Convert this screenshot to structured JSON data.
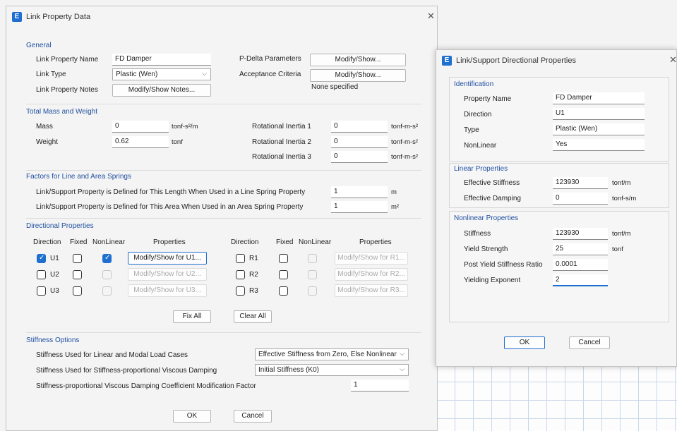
{
  "main": {
    "title": "Link Property Data",
    "general": {
      "header": "General",
      "name_label": "Link Property Name",
      "name_value": "FD Damper",
      "type_label": "Link Type",
      "type_value": "Plastic (Wen)",
      "notes_label": "Link Property Notes",
      "notes_button": "Modify/Show Notes...",
      "pdelta_label": "P-Delta Parameters",
      "pdelta_button": "Modify/Show...",
      "accept_label": "Acceptance Criteria",
      "accept_button": "Modify/Show...",
      "none_specified": "None specified"
    },
    "mass": {
      "header": "Total Mass and Weight",
      "mass_label": "Mass",
      "mass_value": "0",
      "mass_unit": "tonf-s²/m",
      "weight_label": "Weight",
      "weight_value": "0.62",
      "weight_unit": "tonf",
      "ri1_label": "Rotational Inertia 1",
      "ri1_value": "0",
      "ri2_label": "Rotational Inertia 2",
      "ri2_value": "0",
      "ri3_label": "Rotational Inertia 3",
      "ri3_value": "0",
      "ri_unit": "tonf-m-s²"
    },
    "factors": {
      "header": "Factors for Line and Area Springs",
      "line_text": "Link/Support Property is Defined for This Length When Used in a Line Spring Property",
      "line_value": "1",
      "line_unit": "m",
      "area_text": "Link/Support Property is Defined for This Area When Used in an Area Spring Property",
      "area_value": "1",
      "area_unit": "m²"
    },
    "directional": {
      "header": "Directional Properties",
      "col_direction": "Direction",
      "col_fixed": "Fixed",
      "col_nonlinear": "NonLinear",
      "col_properties": "Properties",
      "rows_left": [
        {
          "dir": "U1",
          "button": "Modify/Show for U1..."
        },
        {
          "dir": "U2",
          "button": "Modify/Show for U2..."
        },
        {
          "dir": "U3",
          "button": "Modify/Show for U3..."
        }
      ],
      "rows_right": [
        {
          "dir": "R1",
          "button": "Modify/Show for R1..."
        },
        {
          "dir": "R2",
          "button": "Modify/Show for R2..."
        },
        {
          "dir": "R3",
          "button": "Modify/Show for R3..."
        }
      ],
      "fix_all": "Fix All",
      "clear_all": "Clear All"
    },
    "stiffness": {
      "header": "Stiffness Options",
      "linear_label": "Stiffness Used for Linear and Modal Load Cases",
      "linear_value": "Effective Stiffness from Zero, Else Nonlinear",
      "viscous_label": "Stiffness Used for Stiffness-proportional Viscous Damping",
      "viscous_value": "Initial Stiffness (K0)",
      "coef_label": "Stiffness-proportional Viscous Damping Coefficient Modification Factor",
      "coef_value": "1"
    },
    "ok": "OK",
    "cancel": "Cancel"
  },
  "side": {
    "title": "Link/Support Directional Properties",
    "ident": {
      "header": "Identification",
      "name_label": "Property Name",
      "name_value": "FD Damper",
      "dir_label": "Direction",
      "dir_value": "U1",
      "type_label": "Type",
      "type_value": "Plastic (Wen)",
      "nl_label": "NonLinear",
      "nl_value": "Yes"
    },
    "linear": {
      "header": "Linear Properties",
      "eff_stiff_label": "Effective Stiffness",
      "eff_stiff_value": "123930",
      "eff_stiff_unit": "tonf/m",
      "eff_damp_label": "Effective Damping",
      "eff_damp_value": "0",
      "eff_damp_unit": "tonf-s/m"
    },
    "nonlinear": {
      "header": "Nonlinear Properties",
      "stiff_label": "Stiffness",
      "stiff_value": "123930",
      "stiff_unit": "tonf/m",
      "yield_label": "Yield Strength",
      "yield_value": "25",
      "yield_unit": "tonf",
      "post_label": "Post Yield Stiffness Ratio",
      "post_value": "0.0001",
      "exp_label": "Yielding Exponent",
      "exp_value": "2"
    },
    "ok": "OK",
    "cancel": "Cancel"
  },
  "colors": {
    "accent": "#1f6fd0",
    "group_header": "#1f4f9f"
  }
}
